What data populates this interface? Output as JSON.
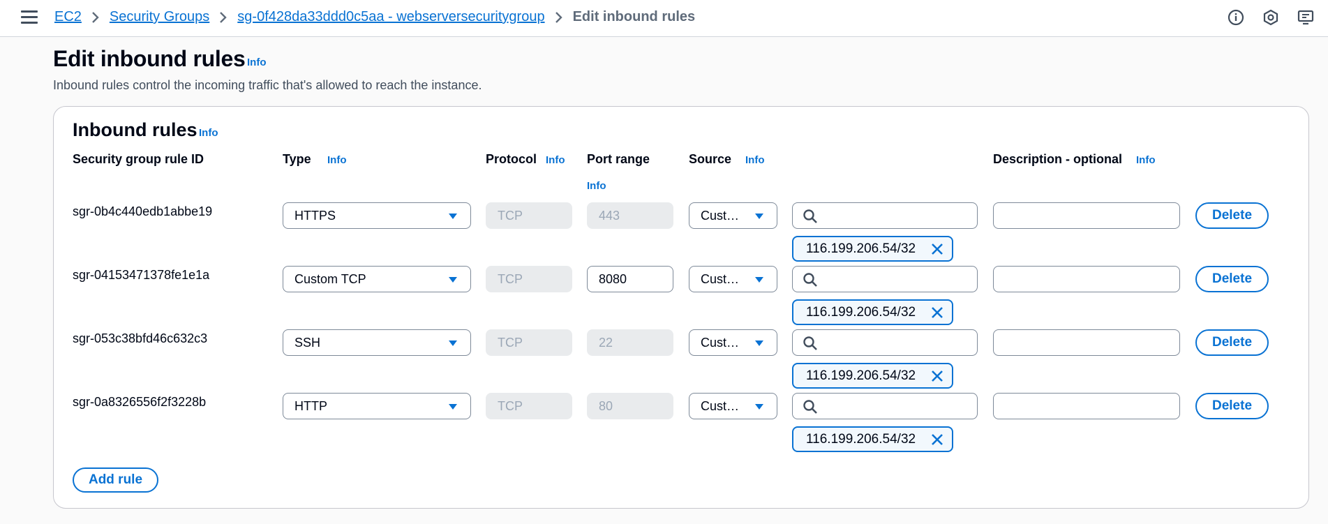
{
  "breadcrumbs": [
    {
      "label": "EC2"
    },
    {
      "label": "Security Groups"
    },
    {
      "label": "sg-0f428da33ddd0c5aa - webserversecuritygroup"
    },
    {
      "label": "Edit inbound rules"
    }
  ],
  "header": {
    "title": "Edit inbound rules",
    "info": "Info",
    "description": "Inbound rules control the incoming traffic that's allowed to reach the instance."
  },
  "panel": {
    "title": "Inbound rules",
    "info": "Info",
    "columns": {
      "rule_id": "Security group rule ID",
      "type": "Type",
      "type_info": "Info",
      "protocol": "Protocol",
      "protocol_info": "Info",
      "port_range": "Port range",
      "port_range_info": "Info",
      "source": "Source",
      "source_info": "Info",
      "description": "Description - optional",
      "description_info": "Info"
    },
    "rules": [
      {
        "id": "sgr-0b4c440edb1abbe19",
        "type": "HTTPS",
        "protocol": "TCP",
        "port": "443",
        "port_editable": false,
        "source": "Cust…",
        "search_value": "",
        "cidr": "116.199.206.54/32",
        "description": "",
        "delete": "Delete"
      },
      {
        "id": "sgr-04153471378fe1e1a",
        "type": "Custom TCP",
        "protocol": "TCP",
        "port": "8080",
        "port_editable": true,
        "source": "Cust…",
        "search_value": "",
        "cidr": "116.199.206.54/32",
        "description": "",
        "delete": "Delete"
      },
      {
        "id": "sgr-053c38bfd46c632c3",
        "type": "SSH",
        "protocol": "TCP",
        "port": "22",
        "port_editable": false,
        "source": "Cust…",
        "search_value": "",
        "cidr": "116.199.206.54/32",
        "description": "",
        "delete": "Delete"
      },
      {
        "id": "sgr-0a8326556f2f3228b",
        "type": "HTTP",
        "protocol": "TCP",
        "port": "80",
        "port_editable": false,
        "source": "Cust…",
        "search_value": "",
        "cidr": "116.199.206.54/32",
        "description": "",
        "delete": "Delete"
      }
    ],
    "add_rule": "Add rule"
  },
  "icons": {
    "menu": "hamburger-icon",
    "info": "info-circle-icon",
    "notifications": "hexagon-settings-icon",
    "feedback": "screen-feedback-icon",
    "caret": "caret-down-icon",
    "search": "search-icon",
    "remove": "close-icon"
  },
  "colors": {
    "accent": "#0972d3",
    "text": "#000716",
    "muted": "#5f6b7a",
    "disabled_bg": "#e9ebed",
    "token_bg": "#f2f8fd"
  }
}
